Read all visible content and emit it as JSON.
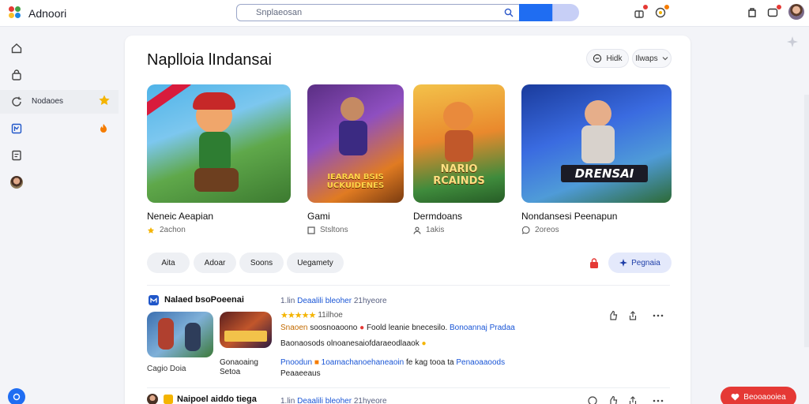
{
  "app": {
    "title": "Adnoori"
  },
  "search": {
    "placeholder": "Snplaeosan"
  },
  "sidebar": {
    "items": [
      {
        "icon": "home-icon"
      },
      {
        "icon": "bag-icon"
      },
      {
        "icon": "refresh-icon",
        "label": "Nodaoes",
        "extra_icon": "star-icon"
      },
      {
        "icon": "library-icon",
        "extra_icon": "flame-icon"
      },
      {
        "icon": "document-icon"
      },
      {
        "icon": "profile-avatar-icon"
      }
    ]
  },
  "page": {
    "title": "Naplloia lIndansai",
    "action_buttons": [
      {
        "label": "Hidk"
      },
      {
        "label": "Ilwaps"
      }
    ]
  },
  "cards": [
    {
      "title": "Neneic Aeapian",
      "meta": "2achon",
      "meta_icon": "star-icon"
    },
    {
      "title": "Gami",
      "meta": "Stsltons",
      "meta_icon": "square-icon"
    },
    {
      "title": "Dermdoans",
      "meta": "1akis",
      "meta_icon": "user-icon"
    },
    {
      "title": "Nondansesi Peenapun",
      "meta": "2oreos",
      "meta_icon": "comment-icon"
    }
  ],
  "banners": [
    {
      "text": ""
    },
    {
      "text": "IEARAN BSIS",
      "text2": "UCKUIDENES"
    },
    {
      "text": "NARIO",
      "text2": "RCAINDS"
    },
    {
      "text": "DRENSAI"
    }
  ],
  "chips": [
    "Aita",
    "Adoar",
    "Soons",
    "Uegamety"
  ],
  "filter_button": {
    "label": "Pegnaia"
  },
  "posts": [
    {
      "title": "Nalaed bsoPoeenai",
      "time": "1.lin",
      "author": "Deaalili bleoher",
      "time_unit": "21hyeore",
      "rating_count": "11ilhoe",
      "line1_a": "Snaoen",
      "line1_b": "soosnoaoono",
      "line1_c": "Foold leanie bnecesilo.",
      "line1_d": "Bonoannaj Pradaa",
      "line2": "Baonaosods olnoanesaiofdaraeodlaaok",
      "line3_a": "Pnoodun",
      "line3_b": "1oamachanoehaneaoin",
      "line3_c": "fe kag",
      "line3_d": "tooa ta",
      "line3_e": "Penaoaaoods",
      "line4": "Peaaeeaus",
      "caption": "Cagio Doia",
      "link_label": "Gonaoaing Setoa"
    },
    {
      "title": "Naipoel aiddo tiega",
      "time": "1.lin",
      "author": "Deaalili bleoher",
      "time_unit": "21hyeore"
    }
  ],
  "fab": {
    "label": "Beooaooiea"
  },
  "colors": {
    "accent": "#1f6df2",
    "danger": "#e53935",
    "star": "#f4b400"
  }
}
